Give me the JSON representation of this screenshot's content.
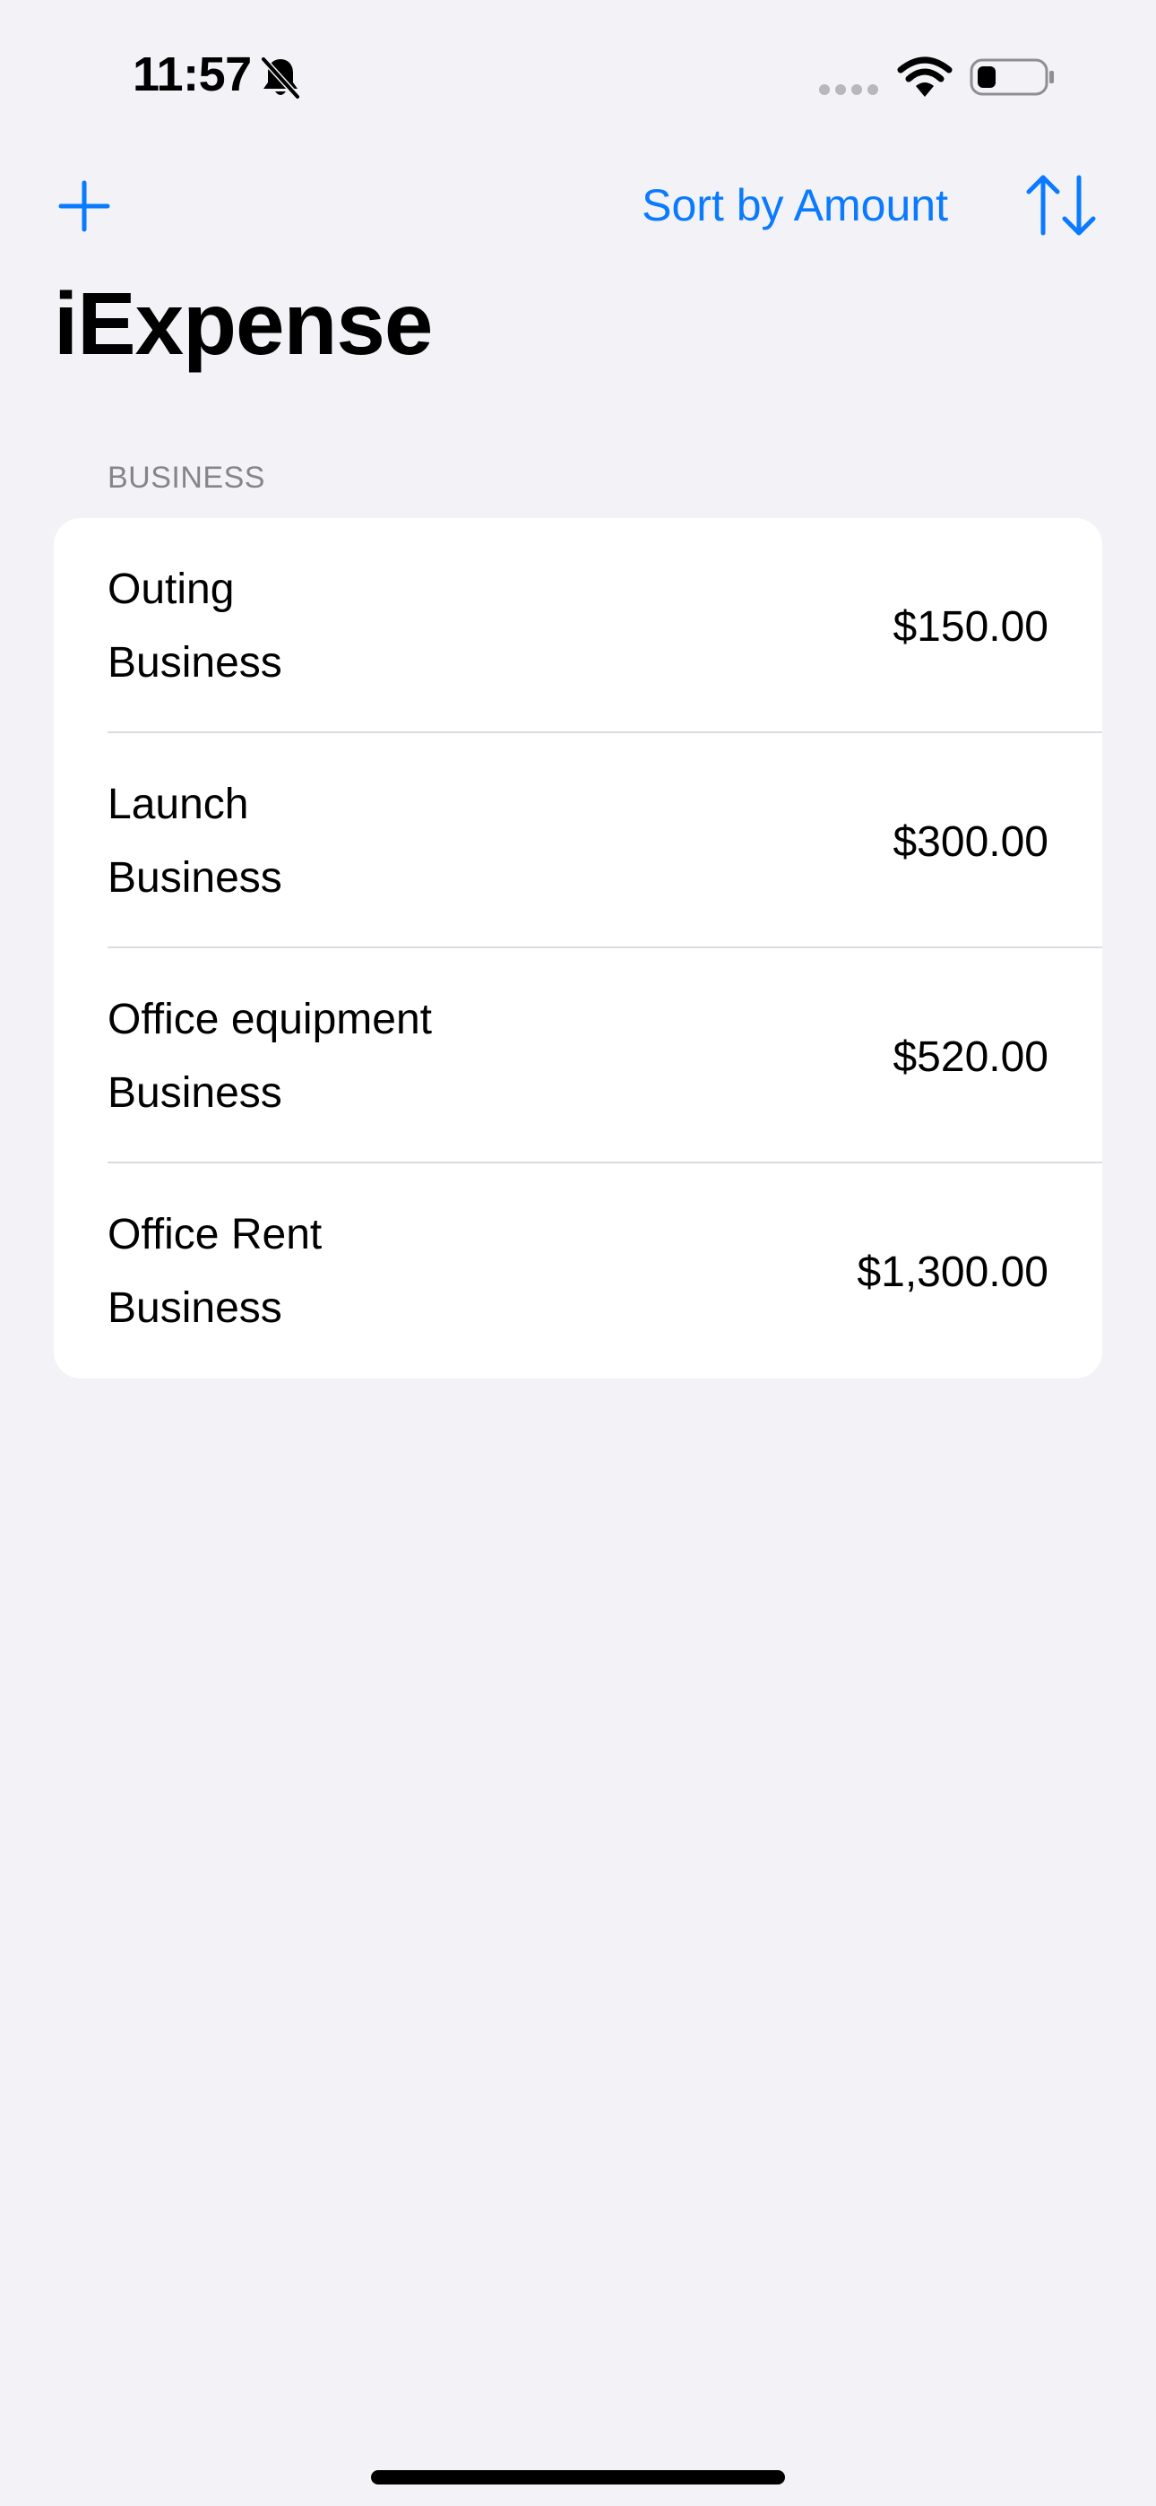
{
  "status_bar": {
    "time": "11:57",
    "icons": [
      "bell-slash-icon",
      "cellular-icon",
      "wifi-icon",
      "battery-icon"
    ]
  },
  "nav": {
    "add_icon": "plus-icon",
    "sort_label": "Sort by Amount",
    "sort_icon": "arrow-up-arrow-down-icon"
  },
  "title": "iExpense",
  "section": {
    "header": "BUSINESS",
    "items": [
      {
        "name": "Outing",
        "type": "Business",
        "amount": "$150.00"
      },
      {
        "name": "Launch",
        "type": "Business",
        "amount": "$300.00"
      },
      {
        "name": "Office equipment",
        "type": "Business",
        "amount": "$520.00"
      },
      {
        "name": "Office Rent",
        "type": "Business",
        "amount": "$1,300.00"
      }
    ]
  },
  "colors": {
    "accent": "#0A7AFF",
    "background": "#F2F2F7",
    "card": "#FFFFFF",
    "secondary_text": "#85858B"
  }
}
